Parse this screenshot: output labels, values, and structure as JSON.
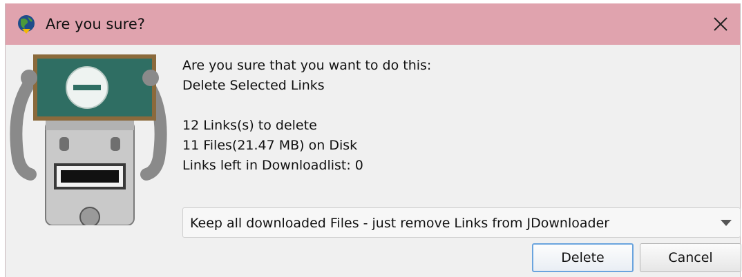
{
  "window": {
    "title": "Are you sure?",
    "close_icon": "close-icon",
    "app_icon": "jdownloader-globe-icon"
  },
  "illustration": {
    "icon": "robot-holding-sign-illustration"
  },
  "message": {
    "question": "Are you sure that you want to do this:",
    "action": "Delete Selected Links",
    "links_to_delete": "12 Links(s) to delete",
    "files_on_disk": "11 Files(21.47 MB) on Disk",
    "links_left": "Links left in Downloadlist: 0"
  },
  "mode_select": {
    "selected": "Keep all downloaded Files - just remove Links from JDownloader"
  },
  "buttons": {
    "delete_label": "Delete",
    "cancel_label": "Cancel"
  },
  "colors": {
    "titlebar": "#e0a3ae",
    "dialog_bg": "#f0f0f0",
    "focus_border": "#6aa4de"
  }
}
